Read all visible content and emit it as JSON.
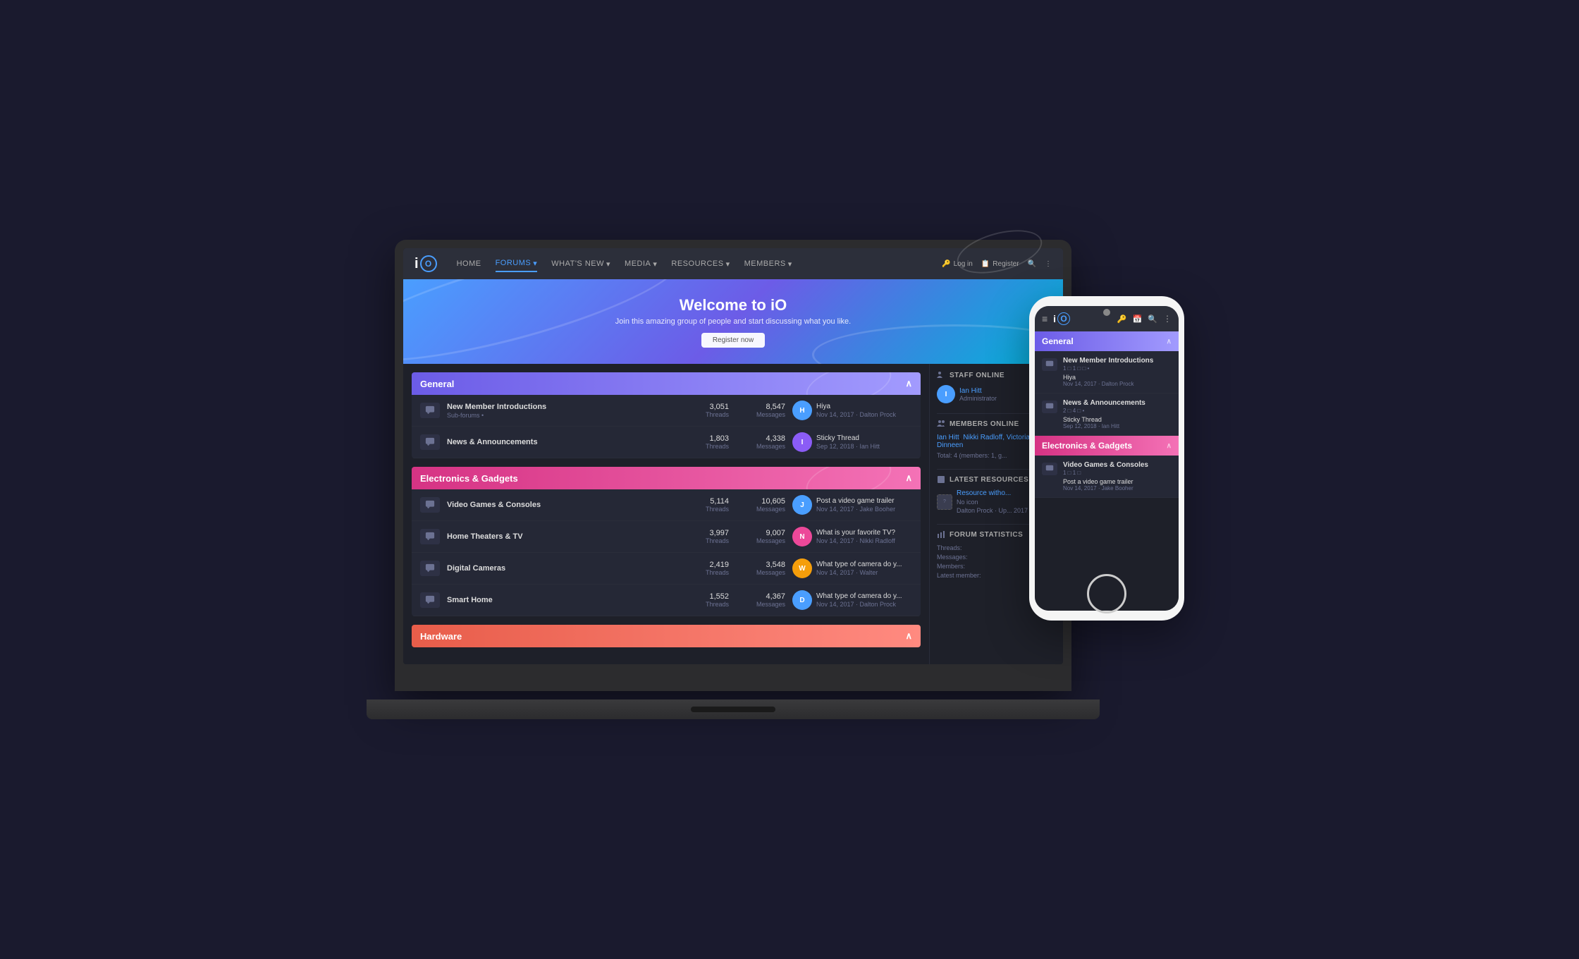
{
  "site": {
    "logo_i": "i",
    "logo_o": "O",
    "title": "iO"
  },
  "nav": {
    "items": [
      {
        "label": "HOME",
        "active": false
      },
      {
        "label": "FORUMS",
        "active": true
      },
      {
        "label": "WHAT'S NEW",
        "active": false
      },
      {
        "label": "MEDIA",
        "active": false
      },
      {
        "label": "RESOURCES",
        "active": false
      },
      {
        "label": "MEMBERS",
        "active": false
      }
    ],
    "login": "Log in",
    "register": "Register"
  },
  "hero": {
    "title": "Welcome to iO",
    "subtitle": "Join this amazing group of people and start discussing what you like.",
    "cta": "Register now"
  },
  "categories": [
    {
      "name": "General",
      "color": "general",
      "forums": [
        {
          "title": "New Member Introductions",
          "sub": "Sub-forums •",
          "threads": "3,051",
          "messages": "8,547",
          "latest_title": "Hiya",
          "latest_date": "Nov 14, 2017",
          "latest_author": "Dalton Prock",
          "avatar_color": "blue"
        },
        {
          "title": "News & Announcements",
          "sub": "",
          "threads": "1,803",
          "messages": "4,338",
          "latest_title": "Sticky Thread",
          "latest_date": "Sep 12, 2018",
          "latest_author": "Ian Hitt",
          "avatar_color": "purple"
        }
      ]
    },
    {
      "name": "Electronics & Gadgets",
      "color": "electronics",
      "forums": [
        {
          "title": "Video Games & Consoles",
          "sub": "",
          "threads": "5,114",
          "messages": "10,605",
          "latest_title": "Post a video game trailer",
          "latest_date": "Nov 14, 2017",
          "latest_author": "Jake Booher",
          "avatar_color": "blue"
        },
        {
          "title": "Home Theaters & TV",
          "sub": "",
          "threads": "3,997",
          "messages": "9,007",
          "latest_title": "What is your favorite TV?",
          "latest_date": "Nov 14, 2017",
          "latest_author": "Nikki Radloff",
          "avatar_color": "pink"
        },
        {
          "title": "Digital Cameras",
          "sub": "",
          "threads": "2,419",
          "messages": "3,548",
          "latest_title": "What type of camera do y...",
          "latest_date": "Nov 14, 2017",
          "latest_author": "Walter",
          "avatar_color": "yellow"
        },
        {
          "title": "Smart Home",
          "sub": "",
          "threads": "1,552",
          "messages": "4,367",
          "latest_title": "What type of camera do y...",
          "latest_date": "Nov 14, 2017",
          "latest_author": "Dalton Prock",
          "avatar_color": "blue"
        }
      ]
    },
    {
      "name": "Hardware",
      "color": "hardware",
      "forums": []
    }
  ],
  "sidebar": {
    "staff_online_title": "Staff online",
    "staff": [
      {
        "name": "Ian Hitt",
        "role": "Administrator",
        "initial": "I"
      }
    ],
    "members_online_title": "Members online",
    "members_online": [
      "Ian Hitt",
      "Nikki Radloff,",
      "Victoria Dinneen"
    ],
    "total": "Total: 4 (members: 1, g...",
    "latest_resources_title": "Latest resources",
    "resource": {
      "title": "Resource witho...",
      "icon": "No icon",
      "meta": "Dalton Prock · Up... 2017"
    },
    "forum_stats_title": "Forum statistics",
    "stats": [
      {
        "label": "Threads:",
        "value": ""
      },
      {
        "label": "Messages:",
        "value": ""
      },
      {
        "label": "Members:",
        "value": ""
      },
      {
        "label": "Latest member:",
        "value": ""
      }
    ]
  },
  "phone": {
    "nav_items": [
      "≡",
      "🔑",
      "📅",
      "🔍",
      "⋮"
    ],
    "general": {
      "header": "General",
      "forums": [
        {
          "title": "New Member Introductions",
          "meta": "1 □ 1 □ □ •",
          "latest": "Hiya",
          "latest_meta": "Nov 14, 2017 · Dalton Prock"
        },
        {
          "title": "News & Announcements",
          "meta": "2 □ 4 □ •",
          "latest": "Sticky Thread",
          "latest_meta": "Sep 12, 2018 · Ian Hitt"
        }
      ]
    },
    "electronics": {
      "header": "Electronics & Gadgets",
      "forums": [
        {
          "title": "Video Games & Consoles",
          "meta": "1 □ 1 □",
          "latest": "Post a video game trailer",
          "latest_meta": "Nov 14, 2017 · Jake Booher"
        }
      ]
    }
  }
}
